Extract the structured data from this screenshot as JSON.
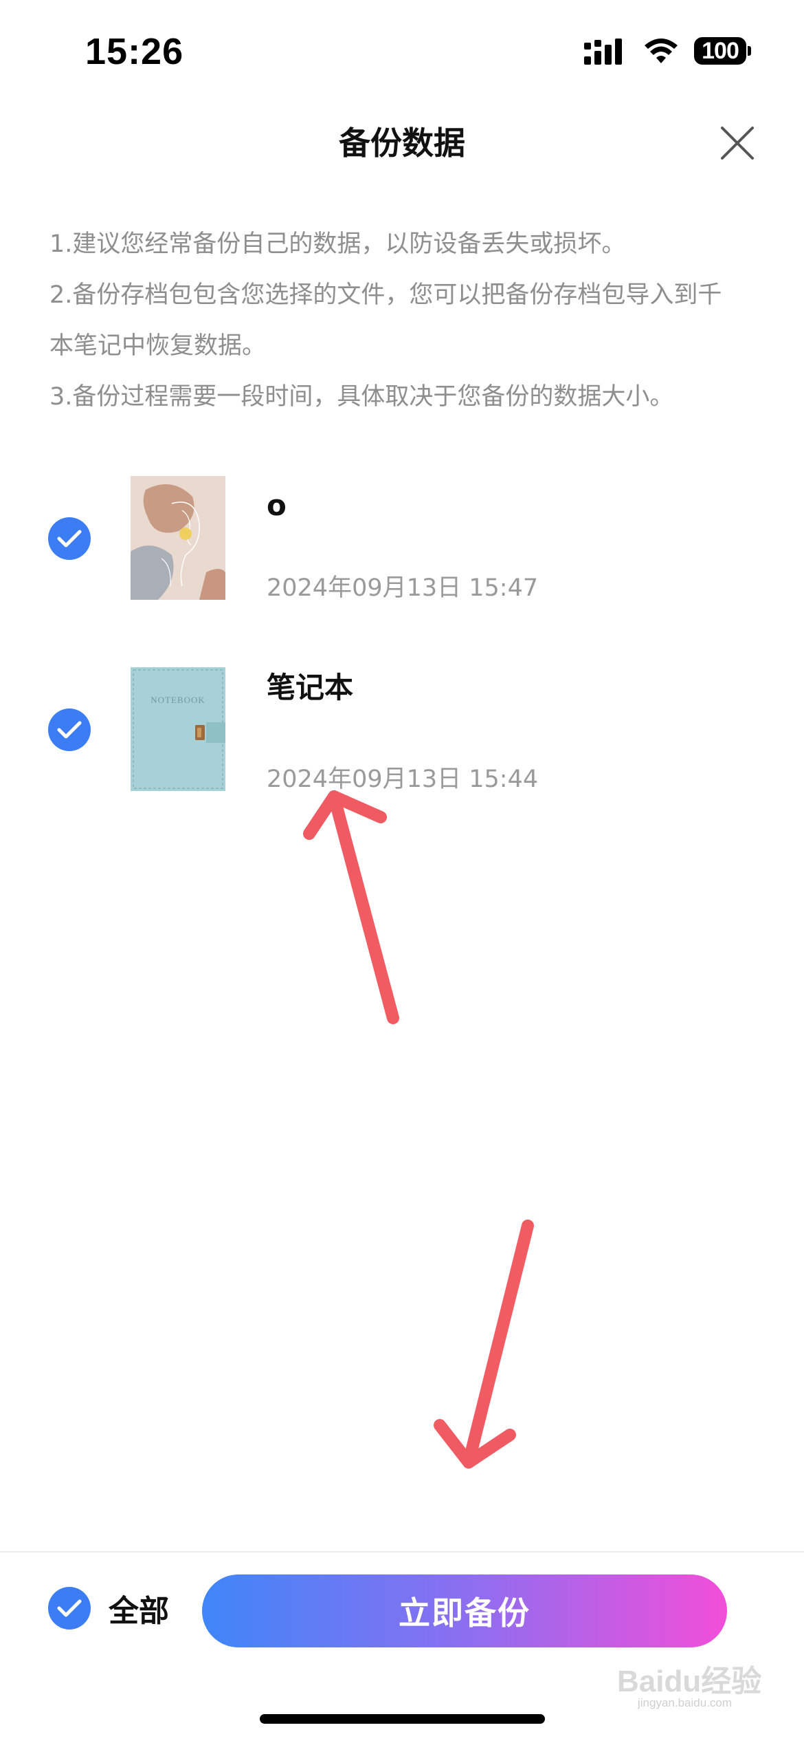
{
  "status_bar": {
    "time": "15:26",
    "battery": "100",
    "icons": [
      "cellular-signal-icon",
      "wifi-icon",
      "battery-icon"
    ]
  },
  "header": {
    "title": "备份数据",
    "close_icon": "close-icon"
  },
  "tips": [
    "1.建议您经常备份自己的数据，以防设备丢失或损坏。",
    "2.备份存档包包含您选择的文件，您可以把备份存档包导入到千",
    "本笔记中恢复数据。",
    "3.备份过程需要一段时间，具体取决于您备份的数据大小。"
  ],
  "notes": [
    {
      "title": "o",
      "date": "2024年09月13日 15:47",
      "checked": true,
      "cover": "illustration-cover"
    },
    {
      "title": "笔记本",
      "date": "2024年09月13日 15:44",
      "checked": true,
      "cover": "teal-notebook-cover",
      "cover_text": "NOTEBOOK"
    }
  ],
  "bottom": {
    "select_all_label": "全部",
    "select_all_checked": true,
    "backup_button_label": "立即备份"
  },
  "colors": {
    "accent_blue": "#3d7df3",
    "button_gradient_start": "#3f86f8",
    "button_gradient_end": "#f24ed8",
    "annotation_arrow": "#f0525a",
    "hint_text": "#8e8e8e"
  },
  "watermark": {
    "brand": "Baidu",
    "text": "经验",
    "url": "jingyan.baidu.com"
  }
}
